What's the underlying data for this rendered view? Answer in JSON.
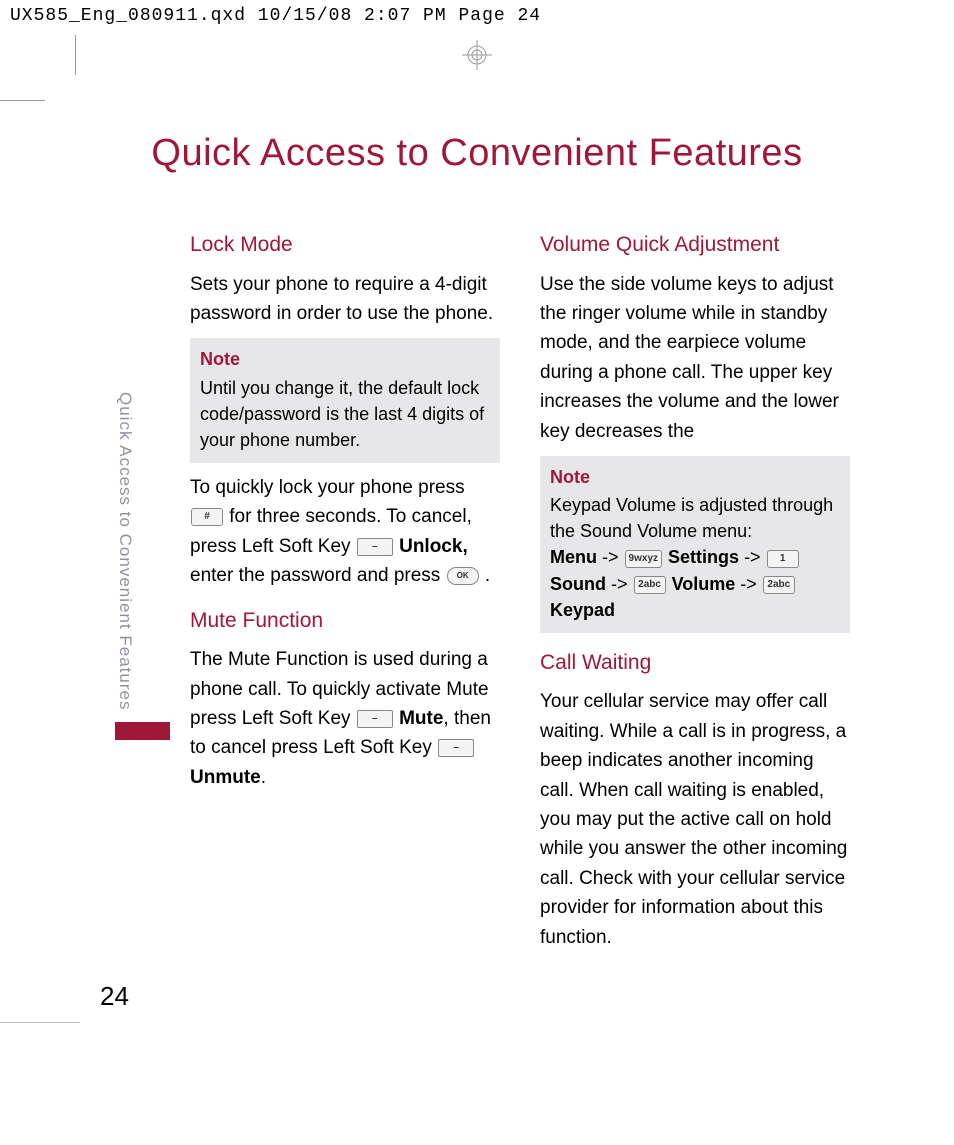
{
  "header": {
    "line": "UX585_Eng_080911.qxd  10/15/08  2:07 PM  Page 24"
  },
  "main_title": "Quick Access to Convenient Features",
  "sidebar_text": "Quick Access to Convenient Features",
  "page_number": "24",
  "col1": {
    "h_lock": "Lock Mode",
    "p_lock": "Sets your phone to require a 4-digit password in order to use the phone.",
    "note_label": "Note",
    "note_body": "Until you change it, the default lock code/password is the last 4 digits of your phone number.",
    "p_lock2a": "To quickly lock your phone press ",
    "p_lock2b": " for three seconds. To cancel, press Left Soft Key ",
    "p_lock2c": "Unlock,",
    "p_lock2d": " enter the password and press ",
    "p_lock2e": " .",
    "h_mute": "Mute Function",
    "p_mute1": "The Mute Function is used during a phone call. To quickly activate Mute press Left Soft Key ",
    "p_mute2": "Mute",
    "p_mute3": ", then to cancel press Left Soft Key ",
    "p_mute4": "Unmute",
    "p_mute5": "."
  },
  "col2": {
    "h_vol": "Volume Quick Adjustment",
    "p_vol": "Use the side volume keys to adjust the ringer volume while in standby mode, and the earpiece volume during a phone call. The upper key increases the volume and the lower key decreases the",
    "note_label": "Note",
    "note_line1": "Keypad Volume is adjusted through the Sound Volume menu:",
    "note_menu": "Menu",
    "note_arrow": "->",
    "note_settings": "Settings",
    "note_sound": "Sound",
    "note_volume": "Volume",
    "note_keypad": "Keypad",
    "key9": "9wxyz",
    "key1": "1",
    "key2a": "2abc",
    "key2b": "2abc",
    "h_call": "Call Waiting",
    "p_call": "Your cellular service may offer call waiting. While a call is in progress, a beep indicates another incoming call. When call waiting is enabled, you may put the active call on hold while you answer the other incoming call. Check with your cellular service provider for information about this function."
  },
  "keys": {
    "hash": "#",
    "soft": "–",
    "ok": "OK"
  }
}
